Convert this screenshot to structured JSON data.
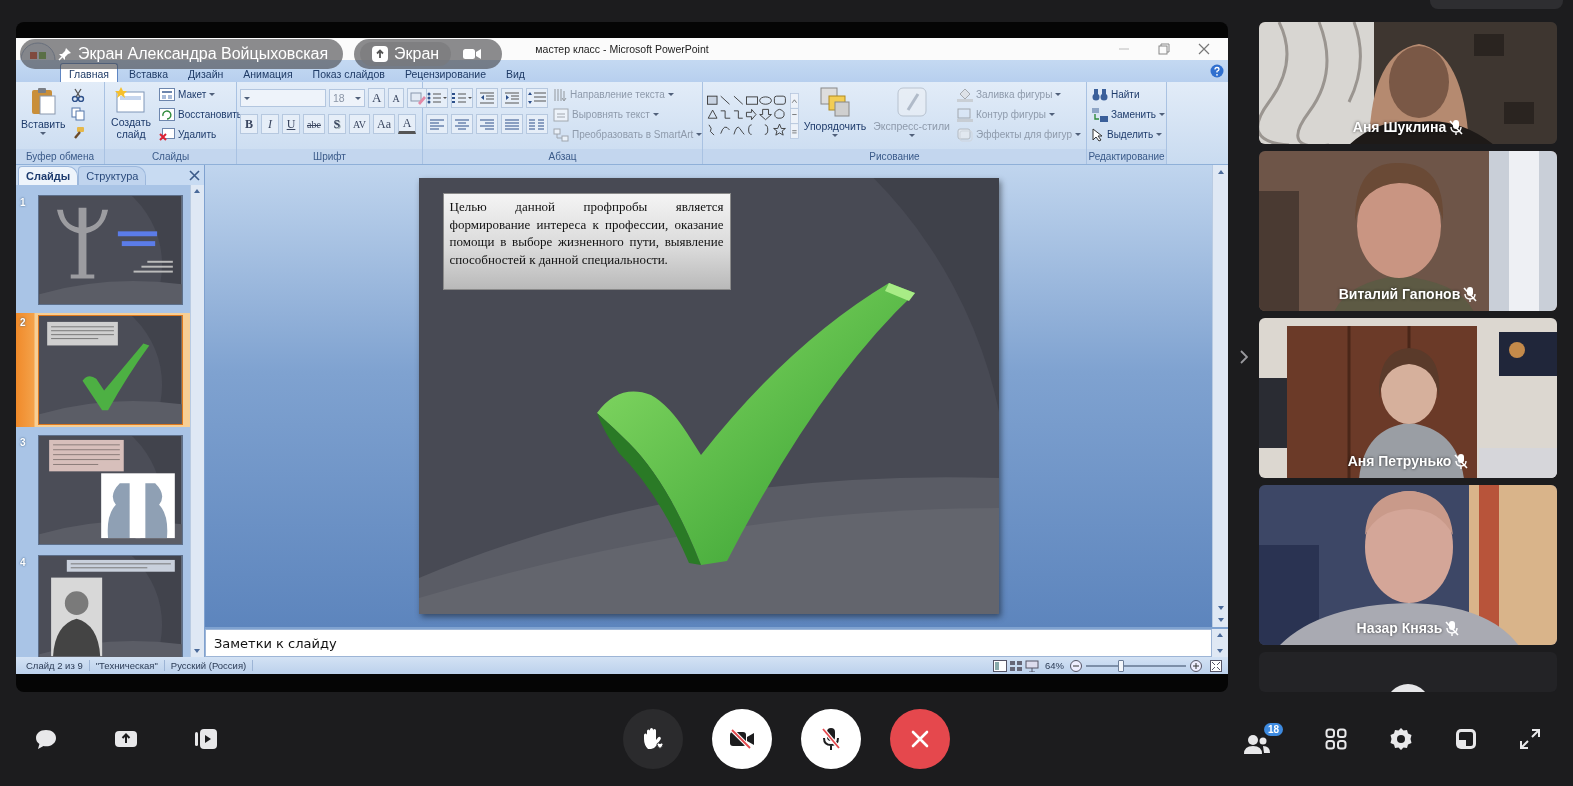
{
  "screen_share": {
    "presenter": "Экран Александра Войцыховская",
    "screen_button": "Экран"
  },
  "powerpoint": {
    "title": "мастер класс - Microsoft PowerPoint",
    "tabs": [
      {
        "label": "Главная",
        "selected": true
      },
      {
        "label": "Вставка",
        "selected": false
      },
      {
        "label": "Дизайн",
        "selected": false
      },
      {
        "label": "Анимация",
        "selected": false
      },
      {
        "label": "Показ слайдов",
        "selected": false
      },
      {
        "label": "Рецензирование",
        "selected": false
      },
      {
        "label": "Вид",
        "selected": false
      }
    ],
    "ribbon": {
      "clipboard": {
        "title": "Буфер обмена",
        "paste": "Вставить"
      },
      "slides": {
        "title": "Слайды",
        "new_slide": "Создать слайд",
        "commands": [
          {
            "label": "Макет",
            "disabled": false
          },
          {
            "label": "Восстановить",
            "disabled": false
          },
          {
            "label": "Удалить",
            "disabled": false
          }
        ]
      },
      "font": {
        "title": "Шрифт",
        "size": "18",
        "size_buttons": [
          "A",
          "A"
        ],
        "format_buttons": [
          "B",
          "I",
          "U",
          "abe",
          "S",
          "AV",
          "Aa",
          "A"
        ]
      },
      "paragraph": {
        "title": "Абзац",
        "commands": [
          {
            "label": "Направление текста",
            "disabled": true
          },
          {
            "label": "Выровнять текст",
            "disabled": true
          },
          {
            "label": "Преобразовать в SmartArt",
            "disabled": true
          }
        ]
      },
      "drawing": {
        "title": "Рисование",
        "arrange": {
          "label": "Упорядочить",
          "disabled": false
        },
        "quick_styles": {
          "label": "Экспресс-стили",
          "disabled": true
        },
        "commands": [
          {
            "label": "Заливка фигуры",
            "disabled": true
          },
          {
            "label": "Контур фигуры",
            "disabled": true
          },
          {
            "label": "Эффекты для фигур",
            "disabled": true
          }
        ]
      },
      "editing": {
        "title": "Редактирование",
        "commands": [
          {
            "label": "Найти",
            "disabled": false
          },
          {
            "label": "Заменить",
            "disabled": false
          },
          {
            "label": "Выделить",
            "disabled": false
          }
        ]
      }
    },
    "slides_pane": {
      "tabs": [
        {
          "label": "Слайды",
          "selected": true
        },
        {
          "label": "Структура",
          "selected": false
        }
      ],
      "thumbnails": [
        {
          "number": "1",
          "selected": false
        },
        {
          "number": "2",
          "selected": true
        },
        {
          "number": "3",
          "selected": false
        },
        {
          "number": "4",
          "selected": false
        }
      ]
    },
    "slide": {
      "text": "Целью данной профпробы является формирование интереса к профессии, оказание помощи в выборе жизненного пути, выявление способностей к данной специальности."
    },
    "notes": {
      "placeholder": "Заметки к слайду"
    },
    "status_bar": {
      "slide_info": "Слайд 2 из 9",
      "theme": "\"Техническая\"",
      "language": "Русский (Россия)",
      "zoom": "64%",
      "zoom_slider": {
        "level": 0.35
      }
    }
  },
  "participants": [
    {
      "name": "Аня Шуклина",
      "muted": true
    },
    {
      "name": "Виталий Гапонов",
      "muted": true
    },
    {
      "name": "Аня Петрунько",
      "muted": true
    },
    {
      "name": "Назар Князь",
      "muted": true
    }
  ],
  "toolbar": {
    "participants_count": "18",
    "camera_on": false,
    "mic_on": false
  }
}
